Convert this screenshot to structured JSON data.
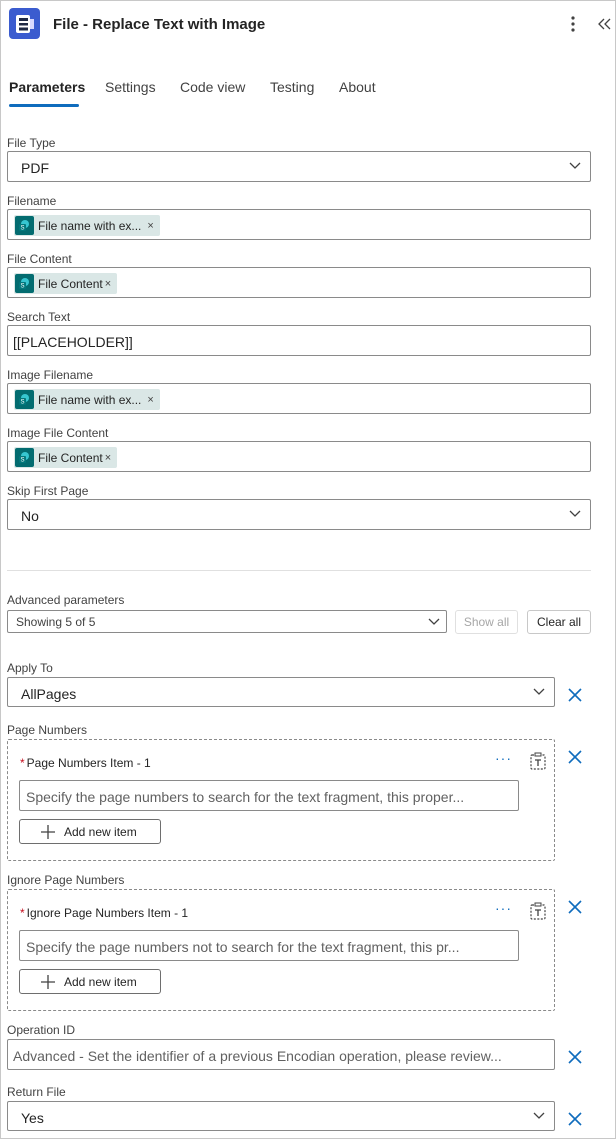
{
  "header": {
    "title": "File - Replace Text with Image",
    "app_icon": "encodian-logo",
    "menu_icon": "more-vertical-icon",
    "collapse_icon": "double-chevron-left-icon"
  },
  "tabs": [
    {
      "label": "Parameters",
      "active": true
    },
    {
      "label": "Settings",
      "active": false
    },
    {
      "label": "Code view",
      "active": false
    },
    {
      "label": "Testing",
      "active": false
    },
    {
      "label": "About",
      "active": false
    }
  ],
  "fields": {
    "file_type": {
      "label": "File Type",
      "value": "PDF"
    },
    "filename": {
      "label": "Filename",
      "token": "File name with ex...",
      "token_icon": "sharepoint-icon"
    },
    "file_content": {
      "label": "File Content",
      "token": "File Content",
      "token_icon": "sharepoint-icon"
    },
    "search_text": {
      "label": "Search Text",
      "value": "[[PLACEHOLDER]]"
    },
    "image_filename": {
      "label": "Image Filename",
      "token": "File name with ex...",
      "token_icon": "sharepoint-icon"
    },
    "image_file_content": {
      "label": "Image File Content",
      "token": "File Content",
      "token_icon": "sharepoint-icon"
    },
    "skip_first_page": {
      "label": "Skip First Page",
      "value": "No"
    }
  },
  "advanced": {
    "label": "Advanced parameters",
    "showing": "Showing 5 of 5",
    "show_all": "Show all",
    "clear_all": "Clear all"
  },
  "apply_to": {
    "label": "Apply To",
    "value": "AllPages"
  },
  "page_numbers": {
    "label": "Page Numbers",
    "item_label": "Page Numbers Item - 1",
    "placeholder": "Specify the page numbers to search for the text fragment, this proper...",
    "add_label": "Add new item"
  },
  "ignore_page_numbers": {
    "label": "Ignore Page Numbers",
    "item_label": "Ignore Page Numbers Item - 1",
    "placeholder": "Specify the page numbers not to search for the text fragment, this pr...",
    "add_label": "Add new item"
  },
  "operation_id": {
    "label": "Operation ID",
    "placeholder": "Advanced - Set the identifier of a previous Encodian operation, please review..."
  },
  "return_file": {
    "label": "Return File",
    "value": "Yes"
  },
  "colors": {
    "accent": "#0f6cbd",
    "token_bg": "#dae7e6",
    "sharepoint": "#036c70",
    "brand": "#3b5ccf"
  }
}
